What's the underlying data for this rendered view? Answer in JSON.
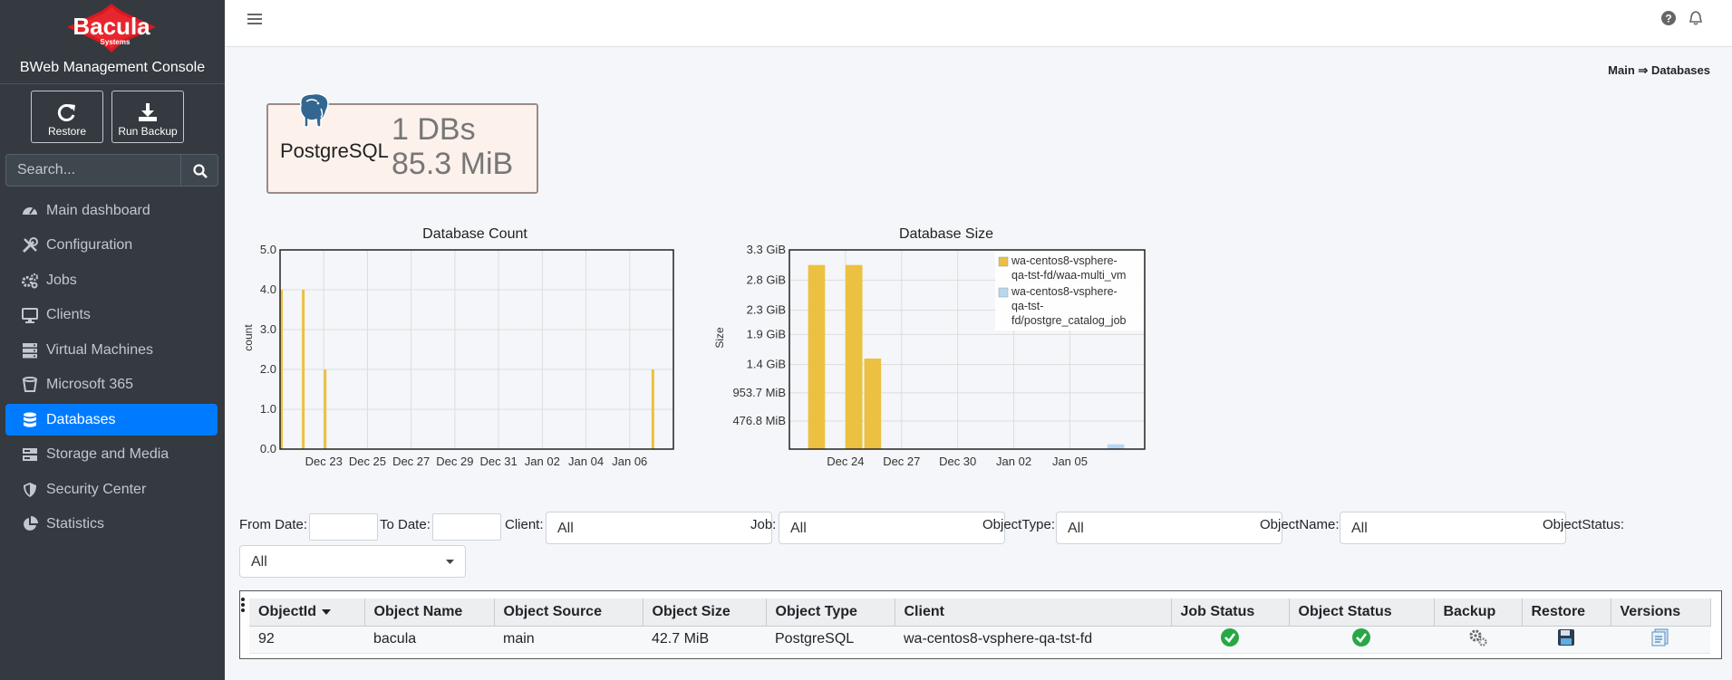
{
  "app": {
    "brand": "Bacula",
    "brand_sub": "Systems",
    "console_title": "BWeb Management Console"
  },
  "sidebar": {
    "restore_label": "Restore",
    "run_backup_label": "Run Backup",
    "search_placeholder": "Search...",
    "items": [
      {
        "label": "Main dashboard",
        "icon": "dashboard-icon"
      },
      {
        "label": "Configuration",
        "icon": "tools-icon"
      },
      {
        "label": "Jobs",
        "icon": "cogs-icon"
      },
      {
        "label": "Clients",
        "icon": "desktop-icon"
      },
      {
        "label": "Virtual Machines",
        "icon": "server-icon"
      },
      {
        "label": "Microsoft 365",
        "icon": "bucket-icon"
      },
      {
        "label": "Databases",
        "icon": "database-icon",
        "active": true
      },
      {
        "label": "Storage and Media",
        "icon": "storage-icon"
      },
      {
        "label": "Security Center",
        "icon": "shield-icon"
      },
      {
        "label": "Statistics",
        "icon": "pie-chart-icon"
      }
    ]
  },
  "breadcrumb": {
    "root": "Main",
    "separator": "⇒",
    "current": "Databases"
  },
  "summary_card": {
    "type_label": "PostgreSQL",
    "db_count": "1 DBs",
    "db_size": "85.3 MiB",
    "icon": "postgresql-elephant-icon"
  },
  "chart_data": [
    {
      "type": "bar",
      "title": "Database Count",
      "xlabel": "",
      "ylabel": "count",
      "ylim": [
        0,
        5
      ],
      "y_ticks": [
        "0.0",
        "1.0",
        "2.0",
        "3.0",
        "4.0",
        "5.0"
      ],
      "x_ticks": [
        "Dec 23",
        "Dec 25",
        "Dec 27",
        "Dec 29",
        "Dec 31",
        "Jan 02",
        "Jan 04",
        "Jan 06"
      ],
      "x_range": [
        "2023-12-21",
        "2024-01-07"
      ],
      "grid": true,
      "series": [
        {
          "color": "#ecc041",
          "points": [
            {
              "x": "2023-12-21",
              "y": 4
            },
            {
              "x": "2023-12-22",
              "y": 4
            },
            {
              "x": "2023-12-23",
              "y": 2
            },
            {
              "x": "2024-01-07",
              "y": 2
            }
          ]
        }
      ]
    },
    {
      "type": "bar",
      "title": "Database Size",
      "xlabel": "",
      "ylabel": "Size",
      "y_max_gib": 3.3,
      "y_ticks": [
        {
          "label": "476.8 MiB",
          "gib": 0.4657
        },
        {
          "label": "953.7 MiB",
          "gib": 0.9313
        },
        {
          "label": "1.4 GiB",
          "gib": 1.4
        },
        {
          "label": "1.9 GiB",
          "gib": 1.9
        },
        {
          "label": "2.3 GiB",
          "gib": 2.3
        },
        {
          "label": "2.8 GiB",
          "gib": 2.8
        },
        {
          "label": "3.3 GiB",
          "gib": 3.3
        }
      ],
      "x_ticks": [
        "Dec 24",
        "Dec 27",
        "Dec 30",
        "Jan 02",
        "Jan 05"
      ],
      "x_range": [
        "2023-12-21",
        "2024-01-08"
      ],
      "grid": true,
      "legend_position": "top-right",
      "series": [
        {
          "name": "wa-centos8-vsphere-qa-tst-fd/waa-multi_vm",
          "legend_lines": [
            "wa-centos8-vsphere-",
            "qa-tst-fd/waa-multi_vm"
          ],
          "color": "#ecc041",
          "points": [
            {
              "x": "2023-12-22",
              "y_gib": 3.05
            },
            {
              "x": "2023-12-24",
              "y_gib": 3.05
            },
            {
              "x": "2023-12-25",
              "y_gib": 1.5
            }
          ]
        },
        {
          "name": "wa-centos8-vsphere-qa-tst-fd/postgre_catalog_job",
          "legend_lines": [
            "wa-centos8-vsphere-",
            "qa-tst-",
            "fd/postgre_catalog_job"
          ],
          "color": "#b7d7f0",
          "points": [
            {
              "x": "2024-01-07",
              "y_gib": 0.08
            }
          ]
        }
      ]
    }
  ],
  "filters": {
    "from_date_label": "From Date:",
    "to_date_label": "To Date:",
    "client_label": "Client:",
    "client_value": "All",
    "job_label": "Job:",
    "job_value": "All",
    "object_type_label": "ObjectType:",
    "object_type_value": "All",
    "object_name_label": "ObjectName:",
    "object_name_value": "All",
    "object_status_label": "ObjectStatus:",
    "object_status_value": "All"
  },
  "table": {
    "columns": [
      "ObjectId",
      "Object Name",
      "Object Source",
      "Object Size",
      "Object Type",
      "Client",
      "Job Status",
      "Object Status",
      "Backup",
      "Restore",
      "Versions"
    ],
    "rows": [
      {
        "object_id": "92",
        "object_name": "bacula",
        "object_source": "main",
        "object_size": "42.7 MiB",
        "object_type": "PostgreSQL",
        "client": "wa-centos8-vsphere-qa-tst-fd",
        "job_status_icon": "success-check-icon",
        "object_status_icon": "success-check-icon",
        "backup_icon": "gears-icon",
        "restore_icon": "floppy-disk-icon",
        "versions_icon": "versions-list-icon"
      }
    ]
  },
  "colors": {
    "sidebar_bg": "#343a40",
    "active_nav": "#007bff",
    "chart_bar": "#ecc041",
    "chart_bar_secondary": "#b7d7f0",
    "success": "#28a745",
    "card_bg": "#fdf1ec"
  }
}
